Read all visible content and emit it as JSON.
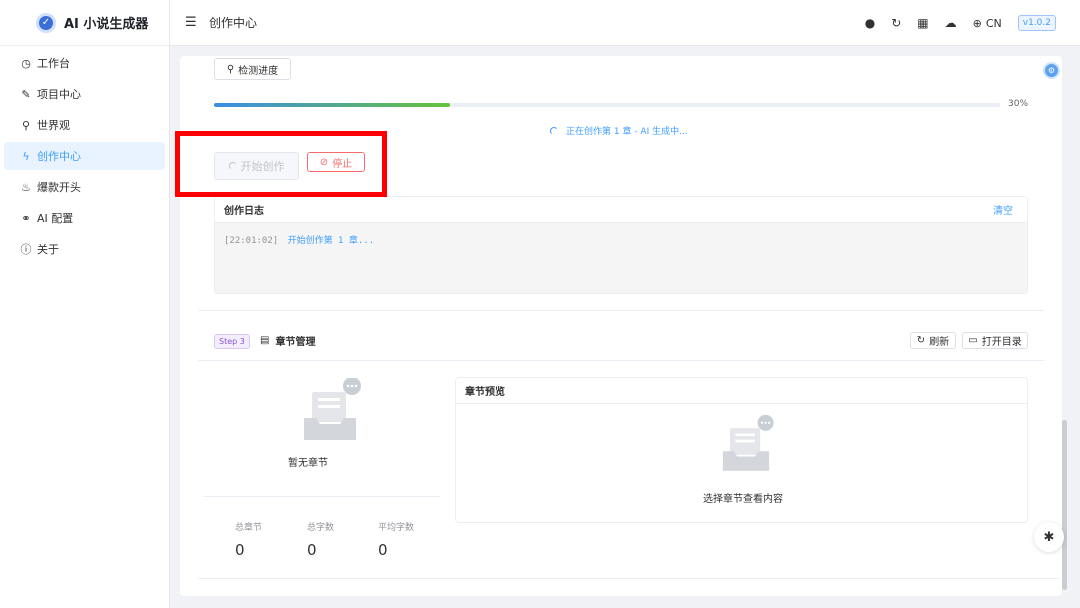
{
  "app": {
    "title": "AI 小说生成器"
  },
  "sidebar": {
    "items": [
      {
        "label": "工作台",
        "icon": "dashboard-icon",
        "glyph": "◷"
      },
      {
        "label": "项目中心",
        "icon": "edit-icon",
        "glyph": "✎"
      },
      {
        "label": "世界观",
        "icon": "world-icon",
        "glyph": "⚲"
      },
      {
        "label": "创作中心",
        "icon": "lightning-icon",
        "glyph": "ϟ"
      },
      {
        "label": "爆款开头",
        "icon": "fire-icon",
        "glyph": "♨"
      },
      {
        "label": "AI 配置",
        "icon": "link-icon",
        "glyph": "⚭"
      },
      {
        "label": "关于",
        "icon": "info-icon",
        "glyph": "ⓘ"
      }
    ],
    "active_index": 3
  },
  "header": {
    "title": "创作中心",
    "lang": "CN",
    "version": "v1.0.2"
  },
  "progress": {
    "check_label": "检测进度",
    "percent_value": 30,
    "percent_text": "30%",
    "status_text": "正在创作第 1 章 - AI 生成中..."
  },
  "actions": {
    "start_label": "开始创作",
    "stop_label": "停止"
  },
  "log": {
    "title": "创作日志",
    "clear_label": "清空",
    "entries": [
      {
        "time": "[22:01:02]",
        "message": "开始创作第 1 章..."
      }
    ]
  },
  "chapters": {
    "step_tag": "Step 3",
    "title": "章节管理",
    "refresh_label": "刷新",
    "open_dir_label": "打开目录",
    "empty_label": "暂无章节",
    "stats": [
      {
        "label": "总章节",
        "value": "0"
      },
      {
        "label": "总字数",
        "value": "0"
      },
      {
        "label": "平均字数",
        "value": "0"
      }
    ],
    "preview_title": "章节预览",
    "preview_empty": "选择章节查看内容"
  },
  "colors": {
    "accent": "#409eff",
    "danger": "#f56c6c",
    "highlight": "#ff0000"
  }
}
